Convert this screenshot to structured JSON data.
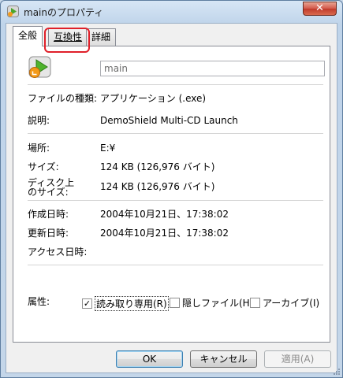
{
  "window": {
    "title": "mainのプロパティ",
    "close_label": "✕"
  },
  "tabs": [
    {
      "label": "全般"
    },
    {
      "label": "互換性"
    },
    {
      "label": "詳細"
    }
  ],
  "general": {
    "name_value": "main",
    "rows": [
      {
        "label": "ファイルの種類:",
        "value": "アプリケーション (.exe)"
      },
      {
        "label": "説明:",
        "value": "DemoShield Multi-CD Launch"
      },
      {
        "label": "場所:",
        "value": "E:¥"
      },
      {
        "label": "サイズ:",
        "value": "124 KB (126,976 バイト)"
      },
      {
        "label_line1": "ディスク上",
        "label_line2": "のサイズ:",
        "value": "124 KB (126,976 バイト)"
      },
      {
        "label": "作成日時:",
        "value": "2004年10月21日、17:38:02"
      },
      {
        "label": "更新日時:",
        "value": "2004年10月21日、17:38:02"
      },
      {
        "label": "アクセス日時:",
        "value": ""
      }
    ],
    "attributes": {
      "label": "属性:",
      "readonly": {
        "label": "読み取り専用(R)",
        "checked": true
      },
      "hidden": {
        "label": "隠しファイル(H)",
        "checked": false
      },
      "archive": {
        "label": "アーカイブ(I)",
        "checked": false
      }
    }
  },
  "buttons": {
    "ok": "OK",
    "cancel": "キャンセル",
    "apply": "適用(A)"
  },
  "colors": {
    "highlight": "#e0202a",
    "close_button": "#c03a2b"
  },
  "icons": {
    "title": "app-launch-icon",
    "file": "app-launch-icon"
  }
}
